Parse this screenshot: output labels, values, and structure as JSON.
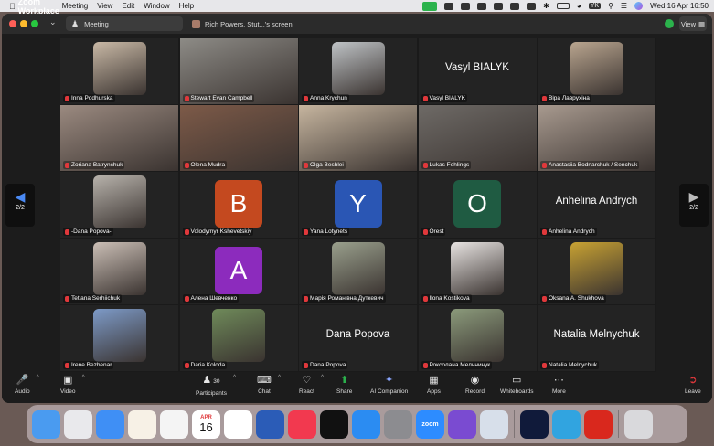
{
  "menubar": {
    "app": "Zoom Workplace",
    "items": [
      "Meeting",
      "View",
      "Edit",
      "Window",
      "Help"
    ],
    "input_source": "YK",
    "clock": "Wed 16 Apr  16:50"
  },
  "titlebar": {
    "meeting_label": "Meeting",
    "share_label": "Rich Powers, Stut...'s screen",
    "view_label": "View"
  },
  "gallery": {
    "page_indicator": "2/2",
    "tiles": [
      {
        "name": "Inna Podhurska",
        "kind": "photo",
        "color": "#c9b9a6"
      },
      {
        "name": "Stewart Evan Campbell",
        "kind": "photo-full",
        "color": "#8d8b86"
      },
      {
        "name": "Anna Krychun",
        "kind": "photo",
        "color": "#bfc3c6"
      },
      {
        "name": "Vasyl BIALYK",
        "kind": "text",
        "big": "Vasyl BIALYK"
      },
      {
        "name": "Віра Лаврухіна",
        "kind": "photo",
        "color": "#b9a58f"
      },
      {
        "name": "Zoriana Batrynchuk",
        "kind": "photo-full",
        "color": "#9b8a80"
      },
      {
        "name": "Olena Mudra",
        "kind": "photo-full",
        "color": "#7d5a48"
      },
      {
        "name": "Olga Beshlei",
        "kind": "photo-full",
        "color": "#c6b59f"
      },
      {
        "name": "Lukas Fehlings",
        "kind": "photo-full",
        "color": "#6e6a66"
      },
      {
        "name": "Anastasiia Bodnarchuk / Senchuk",
        "kind": "photo-full",
        "color": "#a89a8f"
      },
      {
        "name": "-Dana Popova-",
        "kind": "photo",
        "color": "#b7b2ab"
      },
      {
        "name": "Volodymyr Kshevetskiy",
        "kind": "avatar",
        "letter": "B",
        "color": "#c4491f"
      },
      {
        "name": "Yana Lotynets",
        "kind": "avatar",
        "letter": "Y",
        "color": "#2a56b4"
      },
      {
        "name": "Orest",
        "kind": "avatar",
        "letter": "O",
        "color": "#1f5b42"
      },
      {
        "name": "Anhelina Andrych",
        "kind": "text",
        "big": "Anhelina Andrych"
      },
      {
        "name": "Tetiana Serhiichuk",
        "kind": "photo",
        "color": "#cbbfb6"
      },
      {
        "name": "Алена Шевченко",
        "kind": "avatar",
        "letter": "A",
        "color": "#8c2bbd"
      },
      {
        "name": "Марія Романівна Дуткевич",
        "kind": "photo",
        "color": "#9aa08d"
      },
      {
        "name": "Ilona Kostikova",
        "kind": "photo",
        "color": "#e8e4e2"
      },
      {
        "name": "Oksana A. Shukhova",
        "kind": "photo",
        "color": "#c8a233"
      },
      {
        "name": "Irene Bezhenar",
        "kind": "photo",
        "color": "#7d9ac7"
      },
      {
        "name": "Daria Koloda",
        "kind": "photo",
        "color": "#6f8a5a"
      },
      {
        "name": "Dana Popova",
        "kind": "text",
        "big": "Dana Popova"
      },
      {
        "name": "Роксолана Мельничук",
        "kind": "photo",
        "color": "#8b9a7b"
      },
      {
        "name": "Natalia Melnychuk",
        "kind": "text",
        "big": "Natalia Melnychuk"
      }
    ]
  },
  "toolbar": {
    "audio": "Audio",
    "video": "Video",
    "participants": "Participants",
    "participants_count": "30",
    "chat": "Chat",
    "react": "React",
    "share": "Share",
    "ai": "AI Companion",
    "apps": "Apps",
    "record": "Record",
    "whiteboards": "Whiteboards",
    "more": "More",
    "leave": "Leave"
  },
  "dock": {
    "calendar_month": "APR",
    "calendar_day": "16",
    "zoom_label": "zoom",
    "apps": [
      {
        "icon": "finder-icon",
        "color": "#4a9bf0"
      },
      {
        "icon": "launchpad-icon",
        "color": "#e9e9ec"
      },
      {
        "icon": "mail-icon",
        "color": "#3f8ff5"
      },
      {
        "icon": "photos-icon",
        "color": "#f7f1e6"
      },
      {
        "icon": "chrome-icon",
        "color": "#f4f4f4"
      },
      {
        "icon": "calendar-icon",
        "color": "#ffffff"
      },
      {
        "icon": "reminders-icon",
        "color": "#ffffff"
      },
      {
        "icon": "word-icon",
        "color": "#2b5cb7"
      },
      {
        "icon": "music-icon",
        "color": "#f2394f"
      },
      {
        "icon": "tv-icon",
        "color": "#111111"
      },
      {
        "icon": "app-store-icon",
        "color": "#2b8cf2"
      },
      {
        "icon": "settings-icon",
        "color": "#8c8c90"
      },
      {
        "icon": "zoom-icon",
        "color": "#2d8cff"
      },
      {
        "icon": "viber-icon",
        "color": "#7a4bd1"
      },
      {
        "icon": "iphone-mirroring-icon",
        "color": "#d7dfea"
      },
      {
        "icon": "windows-app-icon",
        "color": "#101a3a"
      },
      {
        "icon": "telegram-icon",
        "color": "#31a4e0"
      },
      {
        "icon": "acrobat-icon",
        "color": "#d9281d"
      },
      {
        "icon": "trash-icon",
        "color": "#d9d9dc"
      }
    ]
  }
}
